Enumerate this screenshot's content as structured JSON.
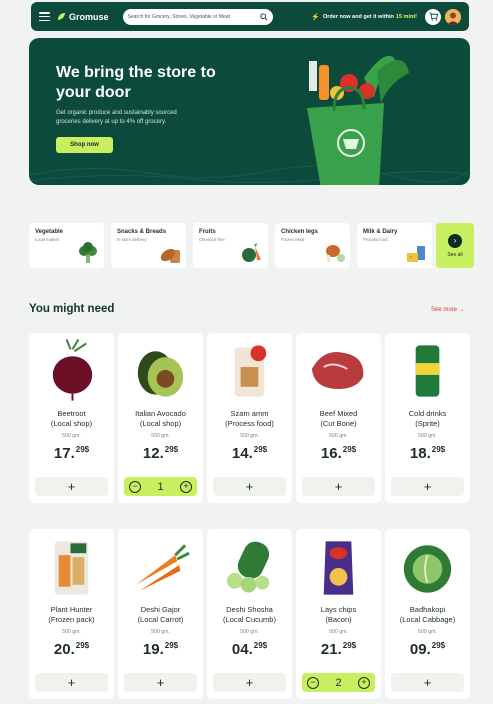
{
  "header": {
    "logo": "Gromuse",
    "search_placeholder": "Search for Grocery, Stores, Vegetable or Meat",
    "promo_text": "Order now and get it within",
    "promo_highlight": "15 mint!"
  },
  "hero": {
    "title": "We bring the store to your door",
    "description": "Get organic produce and sustainably sourced groceries delivery at up to 4% off grocery.",
    "cta": "Shop now"
  },
  "categories": [
    {
      "name": "Vegetable",
      "sub": "Local market",
      "icon": "broccoli-icon"
    },
    {
      "name": "Snacks & Breads",
      "sub": "In store delivery",
      "icon": "bread-icon"
    },
    {
      "name": "Fruits",
      "sub": "Chemical free",
      "icon": "fruit-icon"
    },
    {
      "name": "Chicken legs",
      "sub": "Frozen Meal",
      "icon": "chicken-leg-icon"
    },
    {
      "name": "Milk & Dairy",
      "sub": "Process food",
      "icon": "dairy-icon"
    }
  ],
  "see_all": "See all",
  "section": {
    "title": "You might need",
    "see_more": "See more"
  },
  "products": [
    {
      "name": "Beetroot",
      "sub": "(Local shop)",
      "weight": "500 gm.",
      "price_main": "17.",
      "price_cents": "29$",
      "qty": null,
      "icon": "beetroot-icon"
    },
    {
      "name": "Italian Avocado",
      "sub": "(Local shop)",
      "weight": "500 gm.",
      "price_main": "12.",
      "price_cents": "29$",
      "qty": "1",
      "icon": "avocado-icon"
    },
    {
      "name": "Szam amm",
      "sub": "(Process food)",
      "weight": "500 gm.",
      "price_main": "14.",
      "price_cents": "29$",
      "qty": null,
      "icon": "snack-pack-icon"
    },
    {
      "name": "Beef Mixed",
      "sub": "(Cut Bone)",
      "weight": "500 gm.",
      "price_main": "16.",
      "price_cents": "29$",
      "qty": null,
      "icon": "beef-icon"
    },
    {
      "name": "Cold drinks",
      "sub": "(Sprite)",
      "weight": "500 gm.",
      "price_main": "18.",
      "price_cents": "29$",
      "qty": null,
      "icon": "soda-can-icon"
    },
    {
      "name": "Plant Hunter",
      "sub": "(Frozen pack)",
      "weight": "500 gm.",
      "price_main": "20.",
      "price_cents": "29$",
      "qty": null,
      "icon": "frozen-pack-icon"
    },
    {
      "name": "Deshi Gajor",
      "sub": "(Local Carrot)",
      "weight": "500 gm.",
      "price_main": "19.",
      "price_cents": "29$",
      "qty": null,
      "icon": "carrot-icon"
    },
    {
      "name": "Deshi Shosha",
      "sub": "(Local Cucumb)",
      "weight": "500 gm.",
      "price_main": "04.",
      "price_cents": "29$",
      "qty": null,
      "icon": "cucumber-icon"
    },
    {
      "name": "Lays chips",
      "sub": "(Bacon)",
      "weight": "500 gm.",
      "price_main": "21.",
      "price_cents": "29$",
      "qty": "2",
      "icon": "chips-bag-icon"
    },
    {
      "name": "Badhakopi",
      "sub": "(Local Cabbage)",
      "weight": "500 gm.",
      "price_main": "09.",
      "price_cents": "29$",
      "qty": null,
      "icon": "cabbage-icon"
    }
  ],
  "controls": {
    "plus": "+",
    "minus": "−"
  },
  "colors": {
    "brand_dark": "#0c4a3c",
    "accent_lime": "#c7ef5f",
    "link_red": "#c8412b"
  }
}
